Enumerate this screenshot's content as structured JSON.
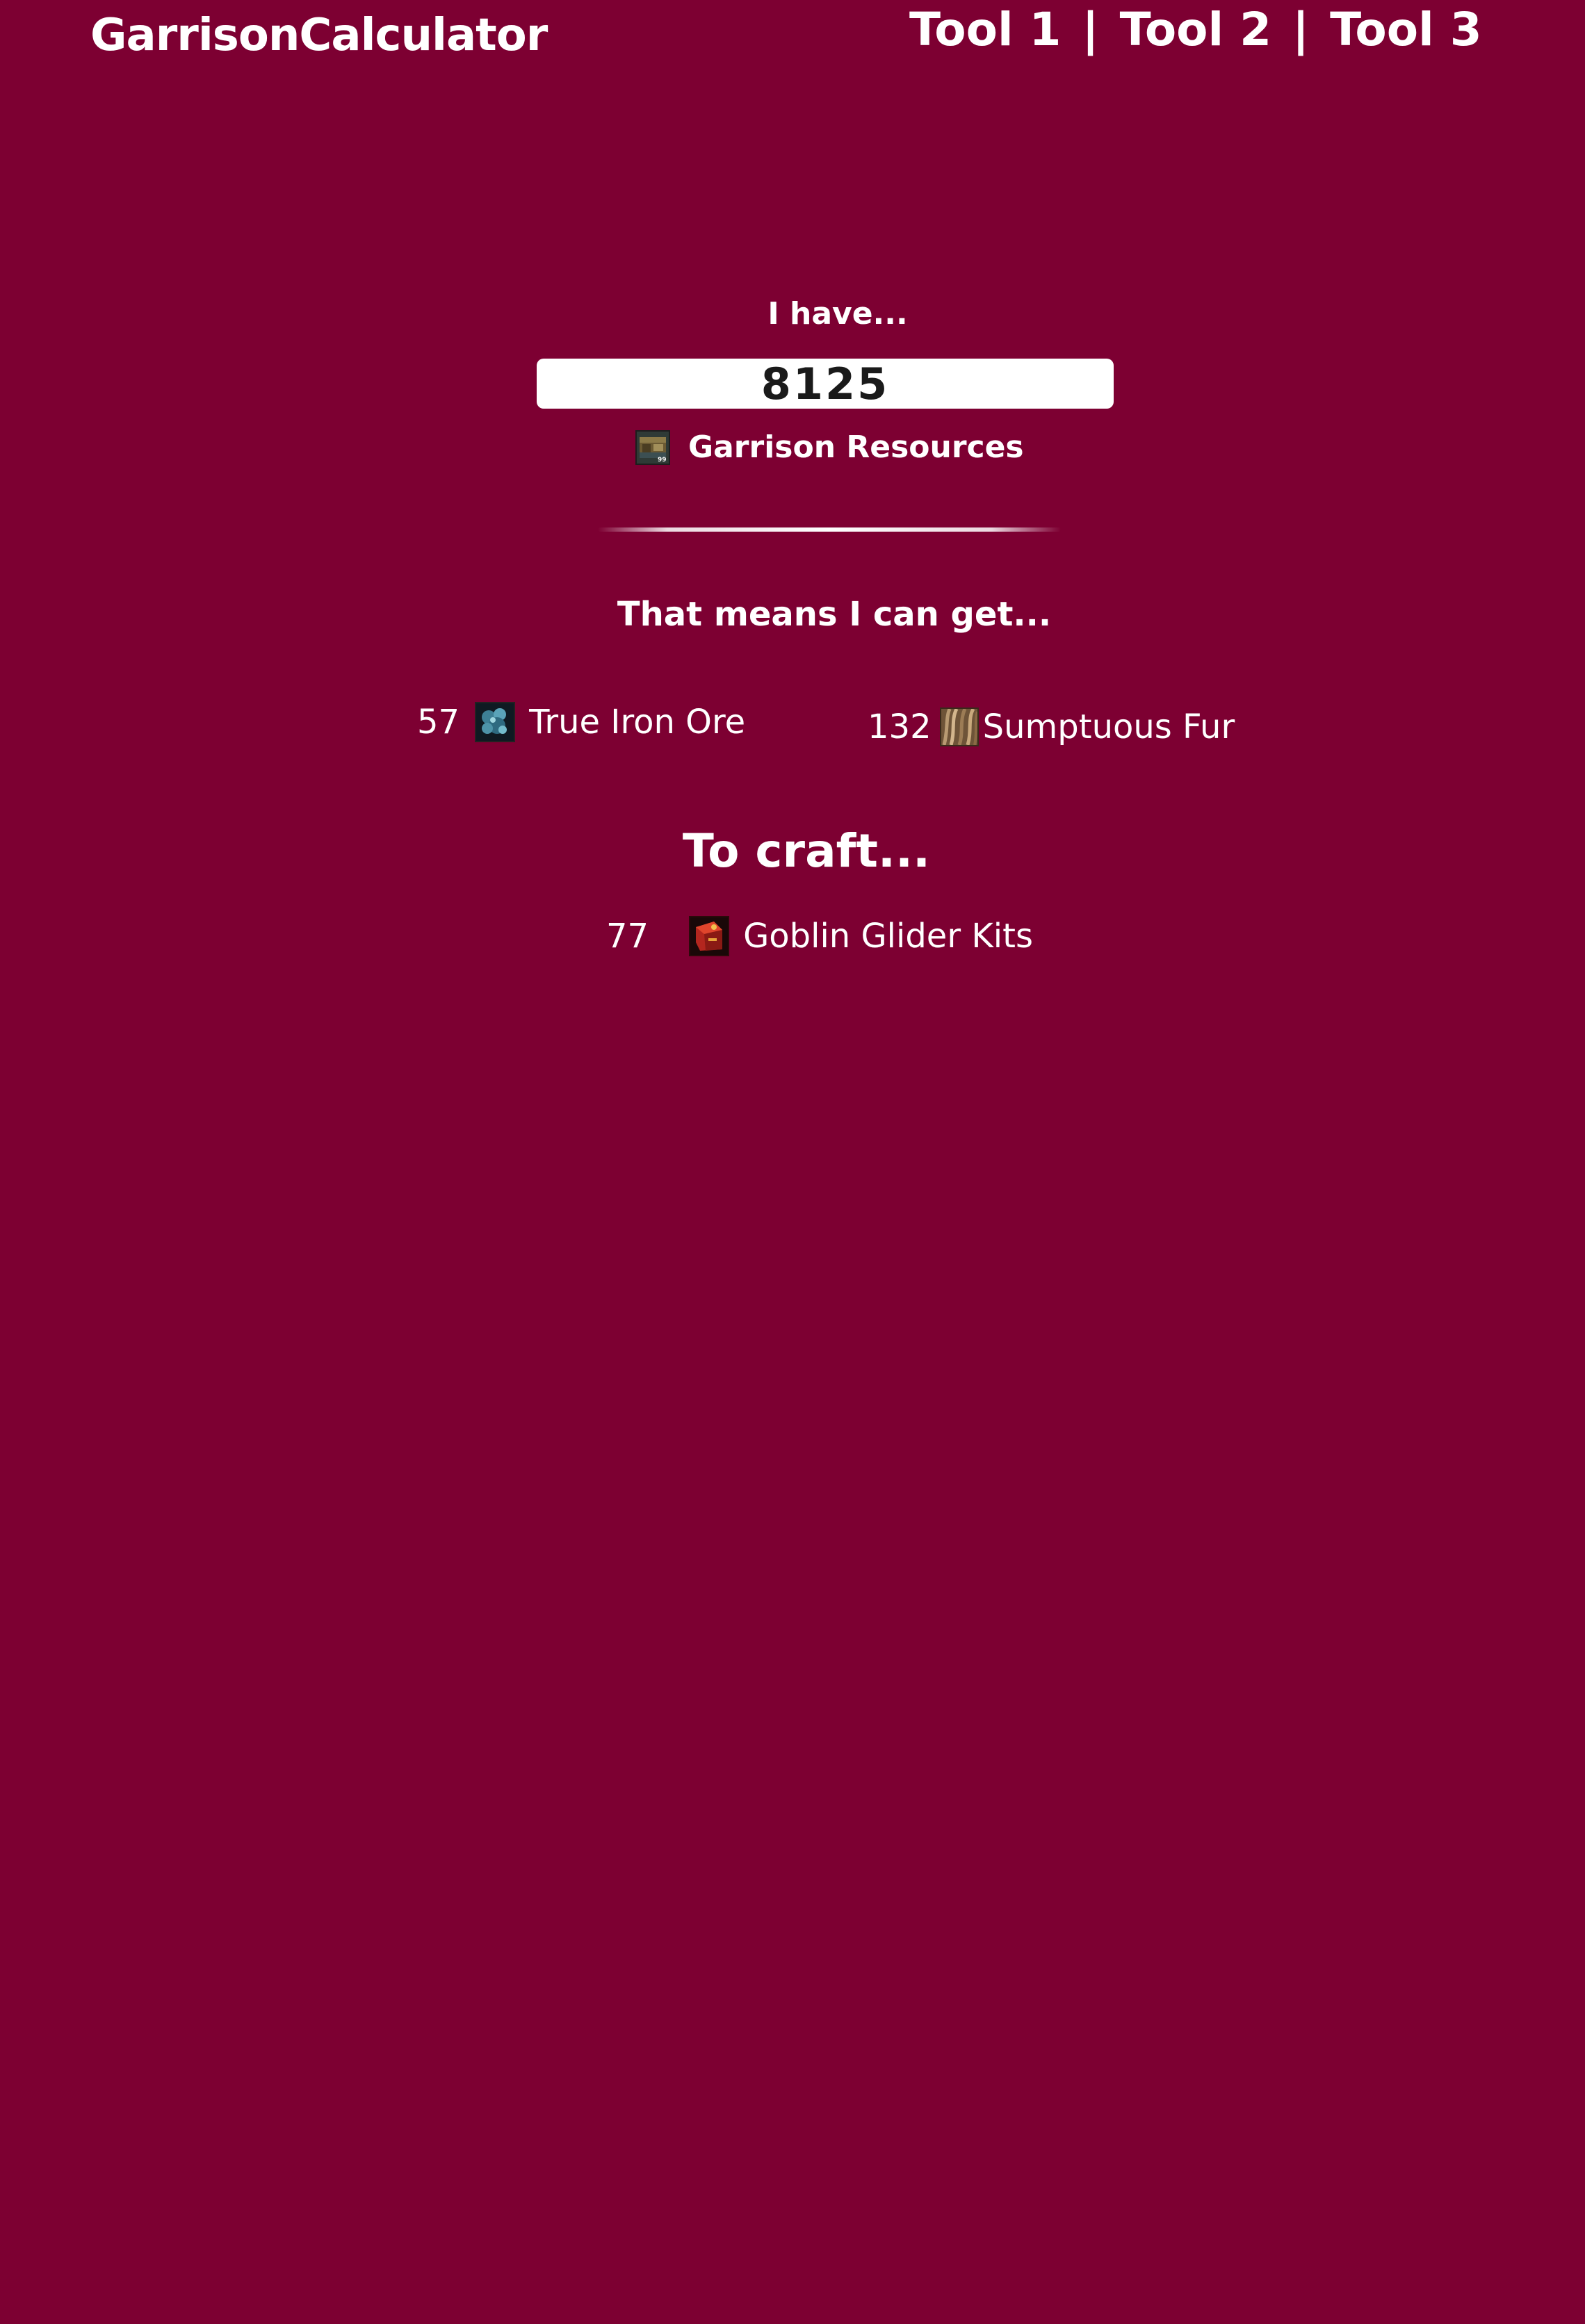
{
  "header": {
    "logo": "GarrisonCalculator",
    "nav": [
      "Tool 1",
      "Tool 2",
      "Tool 3"
    ],
    "nav_separator": "|"
  },
  "input_section": {
    "label": "I have...",
    "amount_value": "8125",
    "resource_icon": "garrison-resources-icon",
    "resource_name": "Garrison Resources"
  },
  "results": {
    "label": "That means I can get...",
    "items": [
      {
        "qty": "57",
        "icon": "true-iron-ore-icon",
        "name": "True Iron Ore"
      },
      {
        "qty": "132",
        "icon": "sumptuous-fur-icon",
        "name": "Sumptuous Fur"
      }
    ]
  },
  "craft": {
    "label": "To craft...",
    "item": {
      "qty": "77",
      "icon": "goblin-glider-kit-icon",
      "name": "Goblin Glider Kits"
    }
  },
  "colors": {
    "background": "#7d0032",
    "text": "#ffffff",
    "input_background": "#ffffff",
    "input_text": "#1a1a1a"
  }
}
